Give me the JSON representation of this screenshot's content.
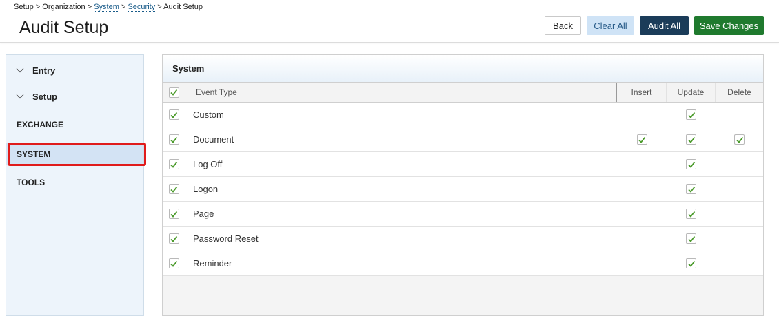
{
  "breadcrumb": {
    "setup": "Setup",
    "sep1": " > ",
    "organization": "Organization",
    "sep2": " > ",
    "system": "System",
    "sep3": " > ",
    "security": "Security",
    "sep4": " > ",
    "current": "Audit Setup"
  },
  "page_title": "Audit Setup",
  "toolbar": {
    "back_label": "Back",
    "clear_all_label": "Clear All",
    "audit_all_label": "Audit All",
    "save_label": "Save Changes"
  },
  "sidebar": {
    "items": [
      {
        "label": "Entry",
        "type": "group",
        "icon": "chevron-down-icon"
      },
      {
        "label": "Setup",
        "type": "group",
        "icon": "chevron-down-icon"
      },
      {
        "label": "EXCHANGE",
        "type": "item"
      },
      {
        "label": "SYSTEM",
        "type": "item",
        "selected": true
      },
      {
        "label": "TOOLS",
        "type": "item"
      }
    ]
  },
  "panel": {
    "title": "System",
    "columns": {
      "event_type": "Event Type",
      "insert": "Insert",
      "update": "Update",
      "delete": "Delete"
    },
    "select_all_checked": true,
    "rows": [
      {
        "event": "Custom",
        "checked": true,
        "insert": false,
        "update": true,
        "delete": false
      },
      {
        "event": "Document",
        "checked": true,
        "insert": true,
        "update": true,
        "delete": true
      },
      {
        "event": "Log Off",
        "checked": true,
        "insert": false,
        "update": true,
        "delete": false
      },
      {
        "event": "Logon",
        "checked": true,
        "insert": false,
        "update": true,
        "delete": false
      },
      {
        "event": "Page",
        "checked": true,
        "insert": false,
        "update": true,
        "delete": false
      },
      {
        "event": "Password Reset",
        "checked": true,
        "insert": false,
        "update": true,
        "delete": false
      },
      {
        "event": "Reminder",
        "checked": true,
        "insert": false,
        "update": true,
        "delete": false
      }
    ]
  },
  "colors": {
    "check_green": "#4a9a2a",
    "audit_all_bg": "#1b3c59",
    "save_bg": "#1f7a2e",
    "clear_all_bg": "#cfe3f6",
    "selection_outline": "#e01b1b"
  }
}
